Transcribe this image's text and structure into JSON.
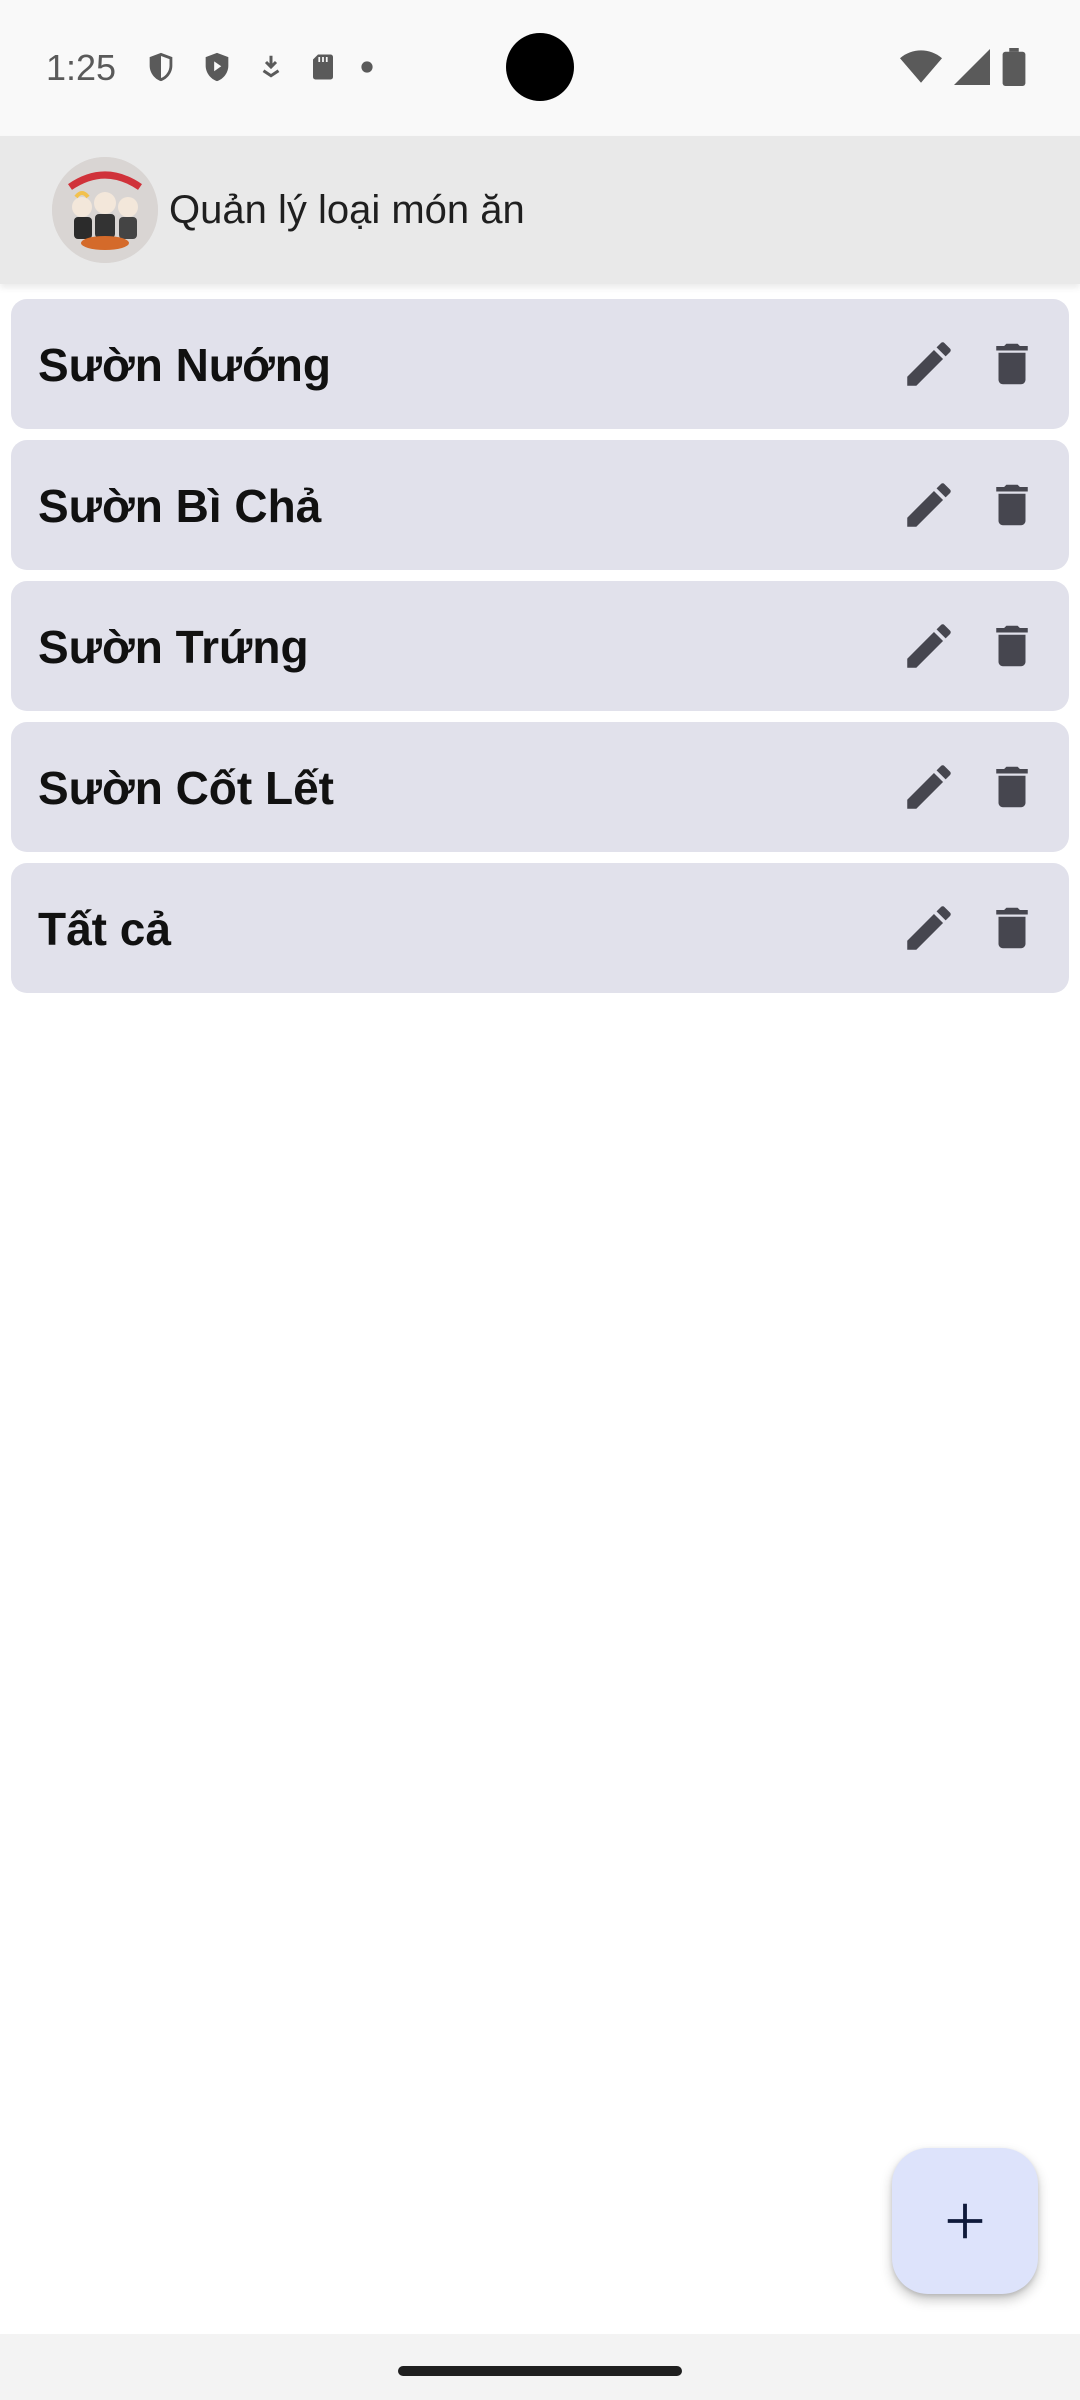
{
  "status_bar": {
    "time": "1:25",
    "left_icons": [
      "vpn-shield-icon",
      "play-protect-icon",
      "download-icon",
      "sd-card-icon",
      "dot-icon"
    ],
    "right_icons": [
      "wifi-icon",
      "signal-icon",
      "battery-icon"
    ]
  },
  "app_bar": {
    "title": "Quản lý loại món ăn",
    "logo": "restaurant-logo"
  },
  "categories": [
    {
      "label": "Sườn Nướng"
    },
    {
      "label": "Sườn Bì Chả"
    },
    {
      "label": "Sườn Trứng"
    },
    {
      "label": "Sườn Cốt Lết"
    },
    {
      "label": "Tất cả"
    }
  ],
  "actions": {
    "edit_icon": "pencil-icon",
    "delete_icon": "trash-icon",
    "add_icon": "plus-icon"
  },
  "colors": {
    "item_background": "#e1e1eb",
    "app_bar_background": "#e9e9e9",
    "fab_background": "#dde3fb",
    "icon_color": "#46464f"
  }
}
